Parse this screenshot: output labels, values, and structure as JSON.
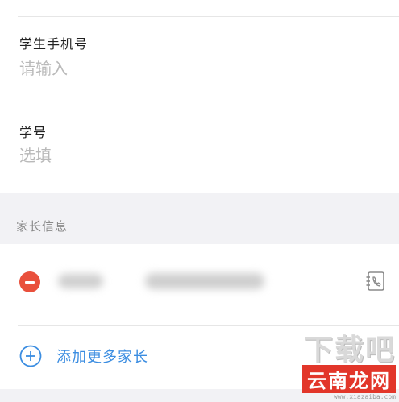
{
  "student_phone": {
    "label": "学生手机号",
    "placeholder": "请输入"
  },
  "student_id": {
    "label": "学号",
    "placeholder": "选填"
  },
  "parents": {
    "header": "家长信息",
    "add_label": "添加更多家长"
  },
  "watermark": {
    "top_text": "下载吧",
    "main_text": "云南龙网",
    "url": "www.xiazaiba.com"
  },
  "colors": {
    "accent": "#3b8de1",
    "remove": "#e9503c",
    "watermark_red": "#e2362a"
  },
  "icons": {
    "remove": "minus-circle-icon",
    "contact": "phone-book-icon",
    "add": "plus-circle-icon"
  }
}
